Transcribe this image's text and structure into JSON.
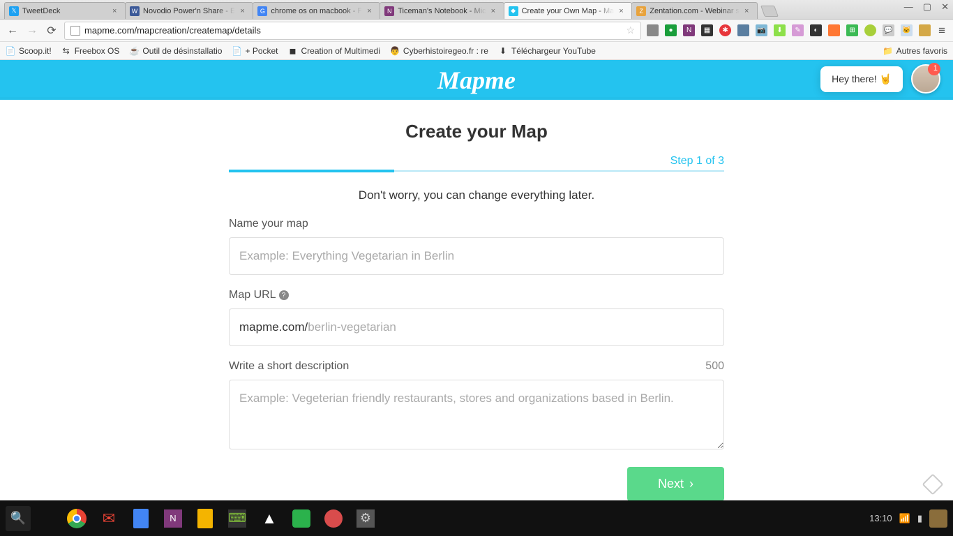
{
  "browser": {
    "tabs": [
      {
        "title": "TweetDeck",
        "icon": "#1da1f2",
        "iconText": "𝕏"
      },
      {
        "title": "Novodio Power'n Share - E",
        "icon": "#3b5998",
        "iconText": "W"
      },
      {
        "title": "chrome os on macbook - F",
        "icon": "#4285f4",
        "iconText": "G"
      },
      {
        "title": "Ticeman's Notebook - Mic",
        "icon": "#80397b",
        "iconText": "N"
      },
      {
        "title": "Create your Own Map - Ma",
        "icon": "#24c3ef",
        "iconText": "◆",
        "active": true
      },
      {
        "title": "Zentation.com - Webinar s",
        "icon": "#e8a33d",
        "iconText": "Z"
      }
    ],
    "url": "mapme.com/mapcreation/createmap/details",
    "bookmarks": [
      {
        "label": "Scoop.it!",
        "icon": "📄"
      },
      {
        "label": "Freebox OS",
        "icon": "⇆"
      },
      {
        "label": "Outil de désinstallatio",
        "icon": "☕"
      },
      {
        "label": "+ Pocket",
        "icon": "📄"
      },
      {
        "label": "Creation of Multimedi",
        "icon": "◼"
      },
      {
        "label": "Cyberhistoiregeo.fr : re",
        "icon": "👨"
      },
      {
        "label": "Téléchargeur YouTube",
        "icon": "⬇"
      }
    ],
    "other_bookmarks": "Autres favoris"
  },
  "page": {
    "logo": "Mapme",
    "heading": "Create your Map",
    "step": "Step 1 of 3",
    "subtitle": "Don't worry, you can change everything later.",
    "name_label": "Name your map",
    "name_placeholder": "Example: Everything Vegetarian in Berlin",
    "url_label": "Map URL",
    "url_prefix": "mapme.com/",
    "url_placeholder": "berlin-vegetarian",
    "desc_label": "Write a short description",
    "char_count": "500",
    "desc_placeholder": "Example: Vegeterian friendly restaurants, stores and organizations based in Berlin.",
    "next": "Next",
    "chat_text": "Hey there! 🤘",
    "chat_badge": "1"
  },
  "taskbar": {
    "time": "13:10"
  }
}
